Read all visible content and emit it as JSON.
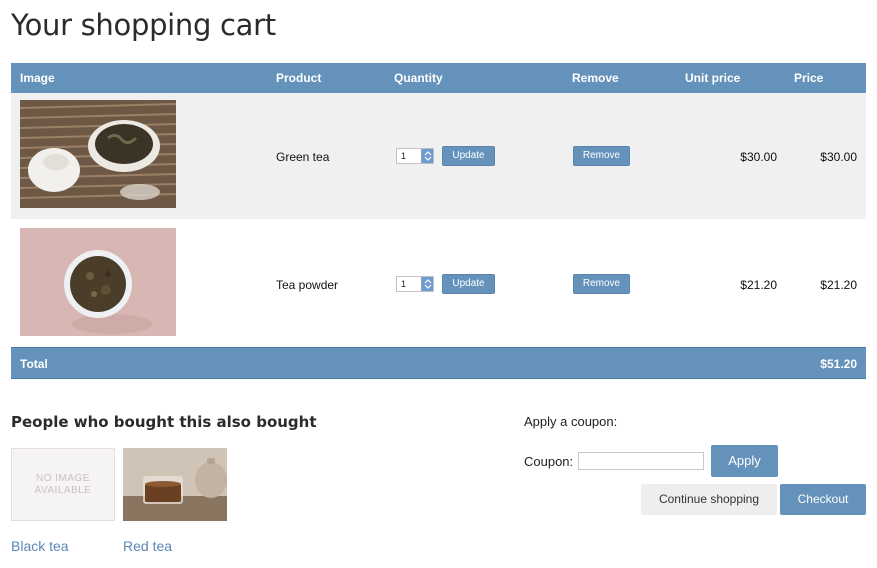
{
  "page": {
    "title": "Your shopping cart"
  },
  "cart": {
    "headers": {
      "image": "Image",
      "product": "Product",
      "quantity": "Quantity",
      "remove": "Remove",
      "unit_price": "Unit price",
      "price": "Price"
    },
    "items": [
      {
        "image_icon": "green-tea-photo",
        "name": "Green tea",
        "quantity": "1",
        "update_label": "Update",
        "remove_label": "Remove",
        "unit_price": "$30.00",
        "price": "$30.00"
      },
      {
        "image_icon": "tea-powder-photo",
        "name": "Tea powder",
        "quantity": "1",
        "update_label": "Update",
        "remove_label": "Remove",
        "unit_price": "$21.20",
        "price": "$21.20"
      }
    ],
    "total": {
      "label": "Total",
      "value": "$51.20"
    }
  },
  "also_bought": {
    "title": "People who bought this also bought",
    "items": [
      {
        "name": "Black tea",
        "image_text": "NO IMAGE AVAILABLE"
      },
      {
        "name": "Red tea",
        "image_icon": "red-tea-photo"
      }
    ]
  },
  "coupon": {
    "title": "Apply a coupon:",
    "label": "Coupon:",
    "value": "",
    "apply_label": "Apply"
  },
  "actions": {
    "continue_label": "Continue shopping",
    "checkout_label": "Checkout"
  },
  "colors": {
    "accent": "#6592bb",
    "row_alt": "#f0f0f0",
    "link": "#5b87b4"
  }
}
